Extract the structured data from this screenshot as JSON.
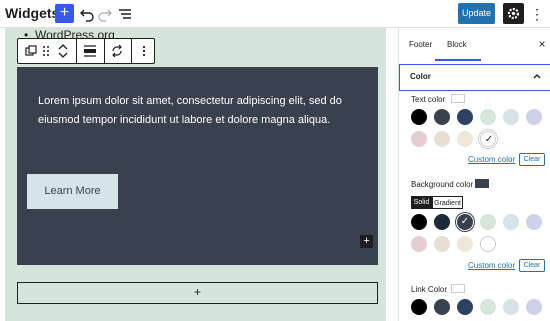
{
  "header": {
    "title": "Widgets",
    "update_label": "Update",
    "icons": [
      "plus-icon",
      "undo-icon",
      "redo-icon",
      "list-view-icon",
      "gear-icon",
      "more-vertical-icon"
    ]
  },
  "canvas": {
    "list_item": "WordPress.org",
    "cover_text": "Lorem ipsum dolor sit amet, consectetur adipiscing elit, sed do eiusmod tempor incididunt ut labore et dolore magna aliqua.",
    "button_label": "Learn More",
    "inline_add": "+",
    "appender_label": "+",
    "cover_color": "#3a414e",
    "area_color": "#d6e5dc"
  },
  "sidebar": {
    "tabs": [
      "Footer",
      "Block"
    ],
    "active_tab": "Block",
    "close": "×",
    "panel_title": "Color",
    "text_color": {
      "label": "Text color",
      "selected": "#ffffff",
      "swatches": [
        "#000000",
        "#3a414e",
        "#2d4263",
        "#d6e5dc",
        "#d6e3e8",
        "#cfd1ea",
        "#e3cfd1",
        "#e8dfd4",
        "#efe8d9",
        "#ffffff"
      ],
      "checked_index": 9,
      "custom_label": "Custom color",
      "clear_label": "Clear"
    },
    "background_color": {
      "label": "Background color",
      "selected": "#3a414e",
      "segments": [
        "Solid",
        "Gradient"
      ],
      "active_segment": "Solid",
      "swatches": [
        "#000000",
        "#1e2a3a",
        "#3a414e",
        "#d6e5dc",
        "#d6e3e8",
        "#cfd1ea",
        "#e3cfd1",
        "#e8dfd4",
        "#efe8d9",
        "#ffffff"
      ],
      "checked_index": 2,
      "custom_label": "Custom color",
      "clear_label": "Clear"
    },
    "link_color": {
      "label": "Link Color",
      "selected": "#ffffff",
      "swatches": [
        "#000000",
        "#3a414e",
        "#2d4263",
        "#d6e5dc",
        "#d6e3e8",
        "#cfd1ea"
      ]
    }
  }
}
